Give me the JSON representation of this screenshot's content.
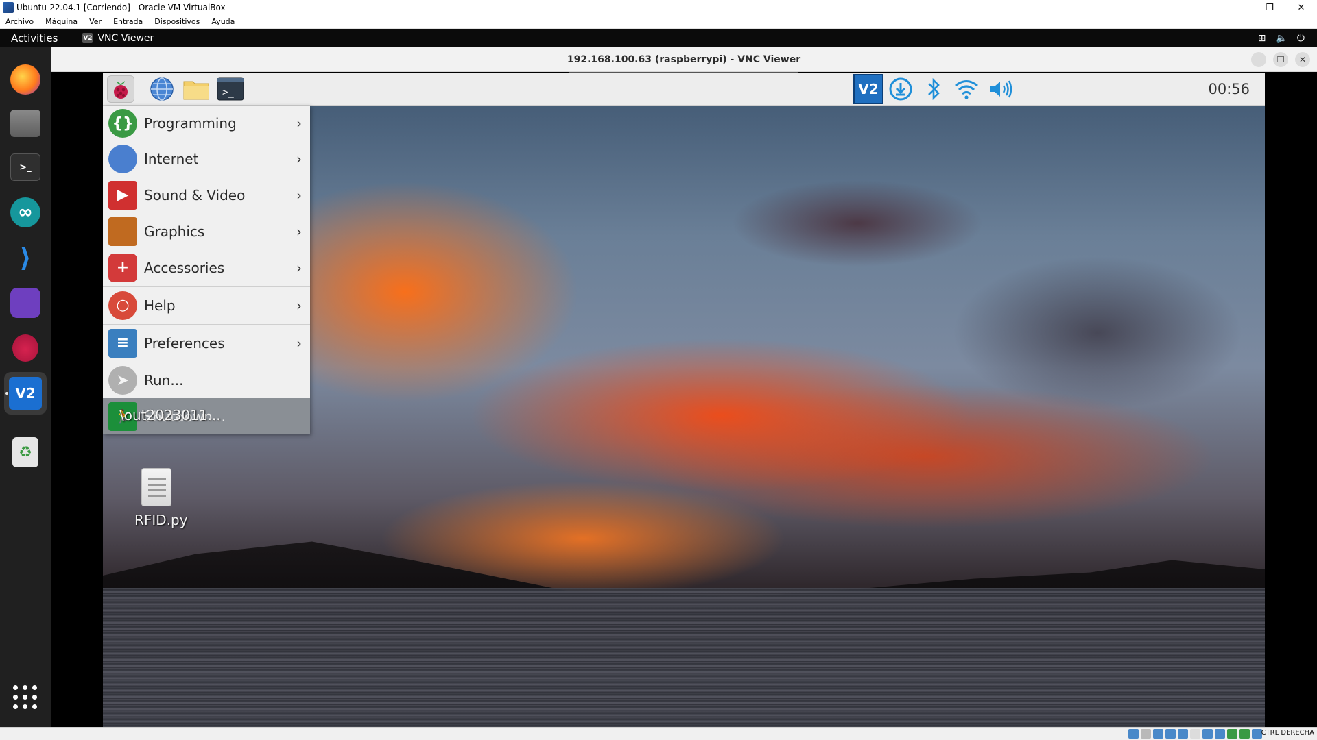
{
  "vbox": {
    "window_title": "Ubuntu-22.04.1 [Corriendo] - Oracle VM VirtualBox",
    "menu": [
      "Archivo",
      "Máquina",
      "Ver",
      "Entrada",
      "Dispositivos",
      "Ayuda"
    ],
    "host_key": "CTRL DERECHA"
  },
  "ubuntu": {
    "activities": "Activities",
    "focused_app": "VNC Viewer",
    "dock": [
      {
        "name": "firefox-icon",
        "glyph": ""
      },
      {
        "name": "files-icon",
        "glyph": ""
      },
      {
        "name": "terminal-icon",
        "glyph": ">_"
      },
      {
        "name": "arduino-icon",
        "glyph": "∞"
      },
      {
        "name": "vscode-icon",
        "glyph": "⟩"
      },
      {
        "name": "github-icon",
        "glyph": ""
      },
      {
        "name": "raspberry-pi-imager-icon",
        "glyph": ""
      },
      {
        "name": "vnc-viewer-icon",
        "glyph": "V2"
      },
      {
        "name": "trash-icon",
        "glyph": "♻"
      }
    ]
  },
  "vnc": {
    "title": "192.168.100.63 (raspberrypi) - VNC Viewer"
  },
  "rpi": {
    "clock": "00:56",
    "menu": [
      {
        "label": "Programming",
        "submenu": true,
        "icon": "programming-icon",
        "color": "#3a9a44",
        "glyph": "{}"
      },
      {
        "label": "Internet",
        "submenu": true,
        "icon": "internet-globe-icon",
        "color": "#4a7fcf",
        "glyph": ""
      },
      {
        "label": "Sound & Video",
        "submenu": true,
        "icon": "sound-video-icon",
        "color": "#d03030",
        "glyph": "▶"
      },
      {
        "label": "Graphics",
        "submenu": true,
        "icon": "graphics-brush-icon",
        "color": "#c06a20",
        "glyph": ""
      },
      {
        "label": "Accessories",
        "submenu": true,
        "icon": "accessories-knife-icon",
        "color": "#d33a3a",
        "glyph": "+"
      },
      {
        "label": "Help",
        "submenu": true,
        "icon": "help-lifebuoy-icon",
        "color": "#d84a3a",
        "glyph": "○"
      },
      {
        "label": "Preferences",
        "submenu": true,
        "icon": "preferences-icon",
        "color": "#3a7fbf",
        "glyph": "≡"
      },
      {
        "label": "Run...",
        "submenu": false,
        "icon": "run-paper-plane-icon",
        "color": "#b0b0b0",
        "glyph": "➤"
      },
      {
        "label": "Shutdown...",
        "submenu": false,
        "icon": "shutdown-exit-icon",
        "color": "#1c8f3a",
        "glyph": "🏃"
      }
    ],
    "desktop_items": [
      {
        "label": "\\out2023011..."
      },
      {
        "label": "RFID.py"
      }
    ]
  }
}
